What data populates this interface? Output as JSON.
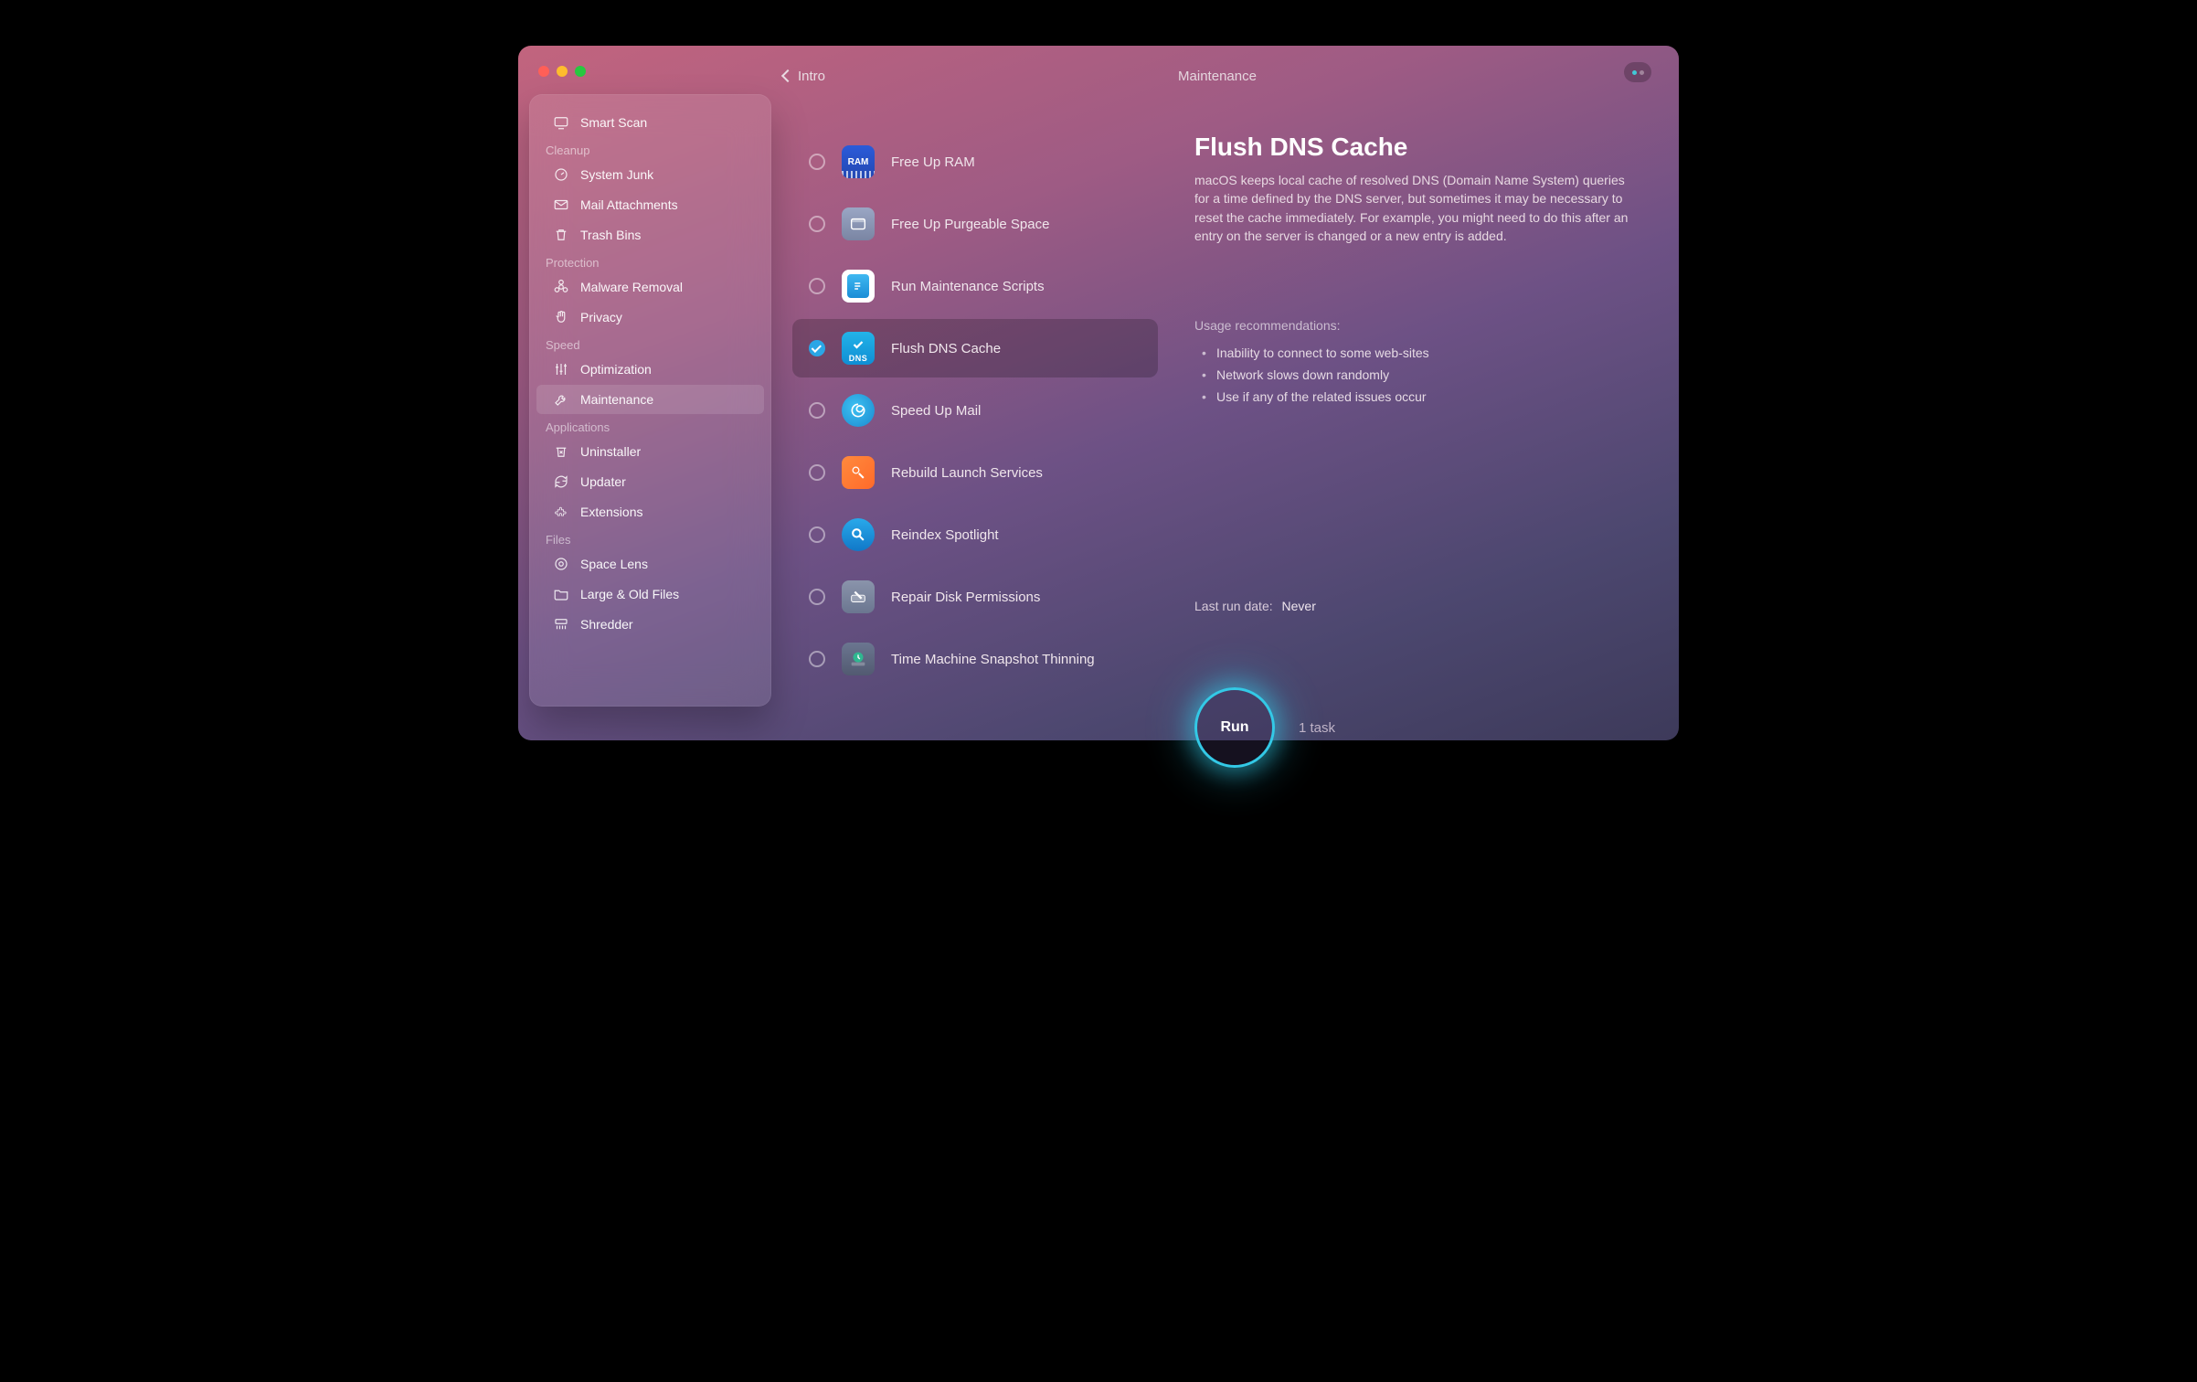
{
  "header": {
    "back": "Intro",
    "title": "Maintenance"
  },
  "sidebar": {
    "top": {
      "label": "Smart Scan"
    },
    "sections": [
      {
        "title": "Cleanup",
        "items": [
          {
            "label": "System Junk"
          },
          {
            "label": "Mail Attachments"
          },
          {
            "label": "Trash Bins"
          }
        ]
      },
      {
        "title": "Protection",
        "items": [
          {
            "label": "Malware Removal"
          },
          {
            "label": "Privacy"
          }
        ]
      },
      {
        "title": "Speed",
        "items": [
          {
            "label": "Optimization"
          },
          {
            "label": "Maintenance"
          }
        ]
      },
      {
        "title": "Applications",
        "items": [
          {
            "label": "Uninstaller"
          },
          {
            "label": "Updater"
          },
          {
            "label": "Extensions"
          }
        ]
      },
      {
        "title": "Files",
        "items": [
          {
            "label": "Space Lens"
          },
          {
            "label": "Large & Old Files"
          },
          {
            "label": "Shredder"
          }
        ]
      }
    ]
  },
  "tasks": [
    {
      "label": "Free Up RAM"
    },
    {
      "label": "Free Up Purgeable Space"
    },
    {
      "label": "Run Maintenance Scripts"
    },
    {
      "label": "Flush DNS Cache"
    },
    {
      "label": "Speed Up Mail"
    },
    {
      "label": "Rebuild Launch Services"
    },
    {
      "label": "Reindex Spotlight"
    },
    {
      "label": "Repair Disk Permissions"
    },
    {
      "label": "Time Machine Snapshot Thinning"
    }
  ],
  "detail": {
    "title": "Flush DNS Cache",
    "description": "macOS keeps local cache of resolved DNS (Domain Name System) queries for a time defined by the DNS server, but sometimes it may be necessary to reset the cache immediately. For example, you might need to do this after an entry on the server is changed or a new entry is added.",
    "usage_heading": "Usage recommendations:",
    "bullets": [
      "Inability to connect to some web-sites",
      "Network slows down randomly",
      "Use if any of the related issues occur"
    ],
    "last_run_label": "Last run date:",
    "last_run_value": "Never"
  },
  "run": {
    "label": "Run",
    "count": "1 task"
  },
  "icons": {
    "ram": "RAM",
    "dns": "DNS"
  }
}
